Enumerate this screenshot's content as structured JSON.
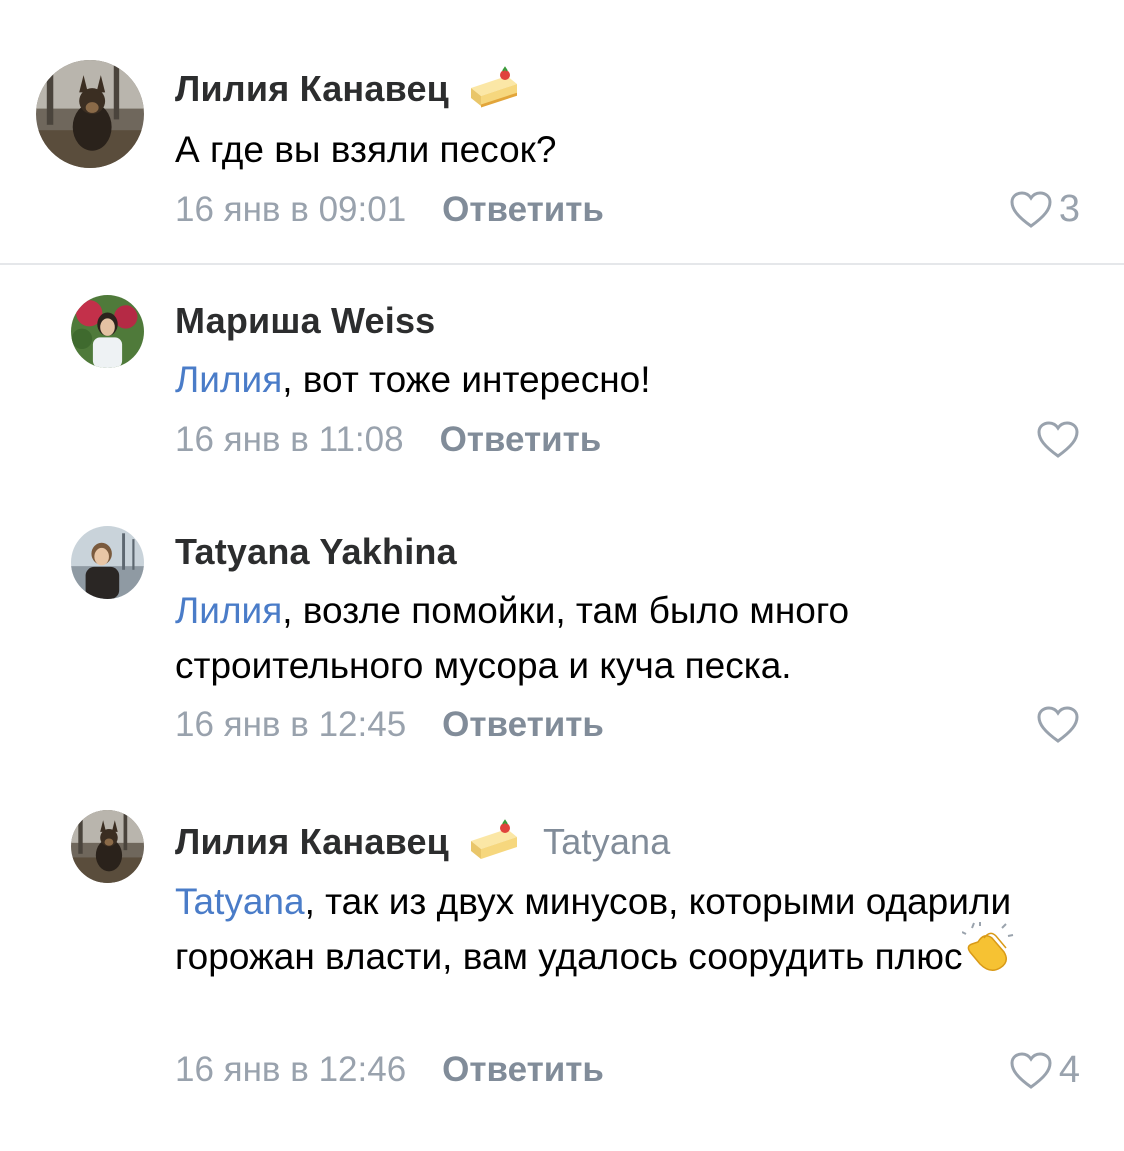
{
  "comments": [
    {
      "author": "Лилия Канавец",
      "text": "А где вы взяли песок?",
      "timestamp": "16 янв в 09:01",
      "reply_label": "Ответить",
      "likes": "3",
      "avatar": "avatar-dog-photo",
      "badge": "cake-icon"
    },
    {
      "author": "Мариша Weiss",
      "mention": "Лилия",
      "text": ", вот тоже интересно!",
      "timestamp": "16 янв в 11:08",
      "reply_label": "Ответить",
      "avatar": "avatar-woman-photo"
    },
    {
      "author": "Tatyana Yakhina",
      "mention": "Лилия",
      "text": ", возле помойки, там было много строительного мусора и куча песка.",
      "timestamp": "16 янв в 12:45",
      "reply_label": "Ответить",
      "avatar": "avatar-person-photo"
    },
    {
      "author": "Лилия Канавец",
      "reply_to": "Tatyana",
      "mention": "Tatyana",
      "text": ", так из двух минусов, которыми одарили горожан власти, вам удалось соорудить плюс",
      "timestamp": "16 янв в 12:46",
      "reply_label": "Ответить",
      "likes": "4",
      "avatar": "avatar-dog-photo",
      "badge": "cake-icon",
      "emoji": "clapping-hands-icon"
    }
  ],
  "colors": {
    "link": "#4a7cc8",
    "meta": "#99a2ad",
    "reply": "#818c99"
  }
}
